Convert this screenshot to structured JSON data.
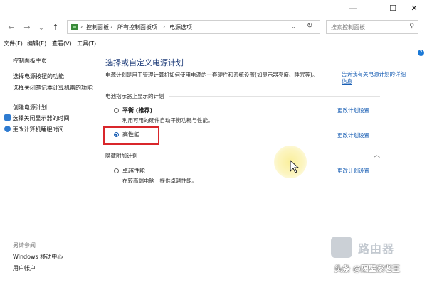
{
  "window": {
    "minimize_icon": "minimize-icon",
    "maximize_icon": "maximize-icon",
    "close_icon": "close-icon"
  },
  "nav": {
    "back": "←",
    "forward": "→",
    "recent": "⌄",
    "up": "↑",
    "breadcrumb": [
      "控制面板",
      "所有控制面板项",
      "电源选项"
    ],
    "separator": "›",
    "search_placeholder": "搜索控制面板"
  },
  "menu": [
    "文件(F)",
    "编辑(E)",
    "查看(V)",
    "工具(T)"
  ],
  "sidebar": {
    "home": "控制面板主页",
    "links": [
      "选择电源按钮的功能",
      "选择关闭笔记本计算机盖的功能",
      "创建电源计划",
      "选择关闭显示器的时间",
      "更改计算机睡眠时间"
    ],
    "see_also_title": "另请参阅",
    "see_also": [
      "Windows 移动中心",
      "用户帐户"
    ]
  },
  "main": {
    "title": "选择或自定义电源计划",
    "description": "电源计划是用于管理计算机如何使用电源的一套硬件和系统设置(如显示器亮度、睡眠等)。",
    "desc_link": "告诉我有关电源计划的详细信息",
    "battery_section": "电池指示器上显示的计划",
    "plans": [
      {
        "name": "平衡 (推荐)",
        "desc": "利用可用的硬件自动平衡功耗与性能。",
        "change": "更改计划设置",
        "selected": false
      },
      {
        "name": "高性能",
        "desc": "",
        "change": "更改计划设置",
        "selected": true
      }
    ],
    "hidden_section": "隐藏附加计划",
    "hidden_plans": [
      {
        "name": "卓越性能",
        "desc": "在较高端电脑上提供卓越性能。",
        "change": "更改计划设置",
        "selected": false
      }
    ]
  },
  "watermarks": {
    "site": "路由器",
    "author": "头条 @隔壁家老王"
  },
  "colors": {
    "accent": "#1a5fb4",
    "highlight_box": "#d9262b"
  }
}
